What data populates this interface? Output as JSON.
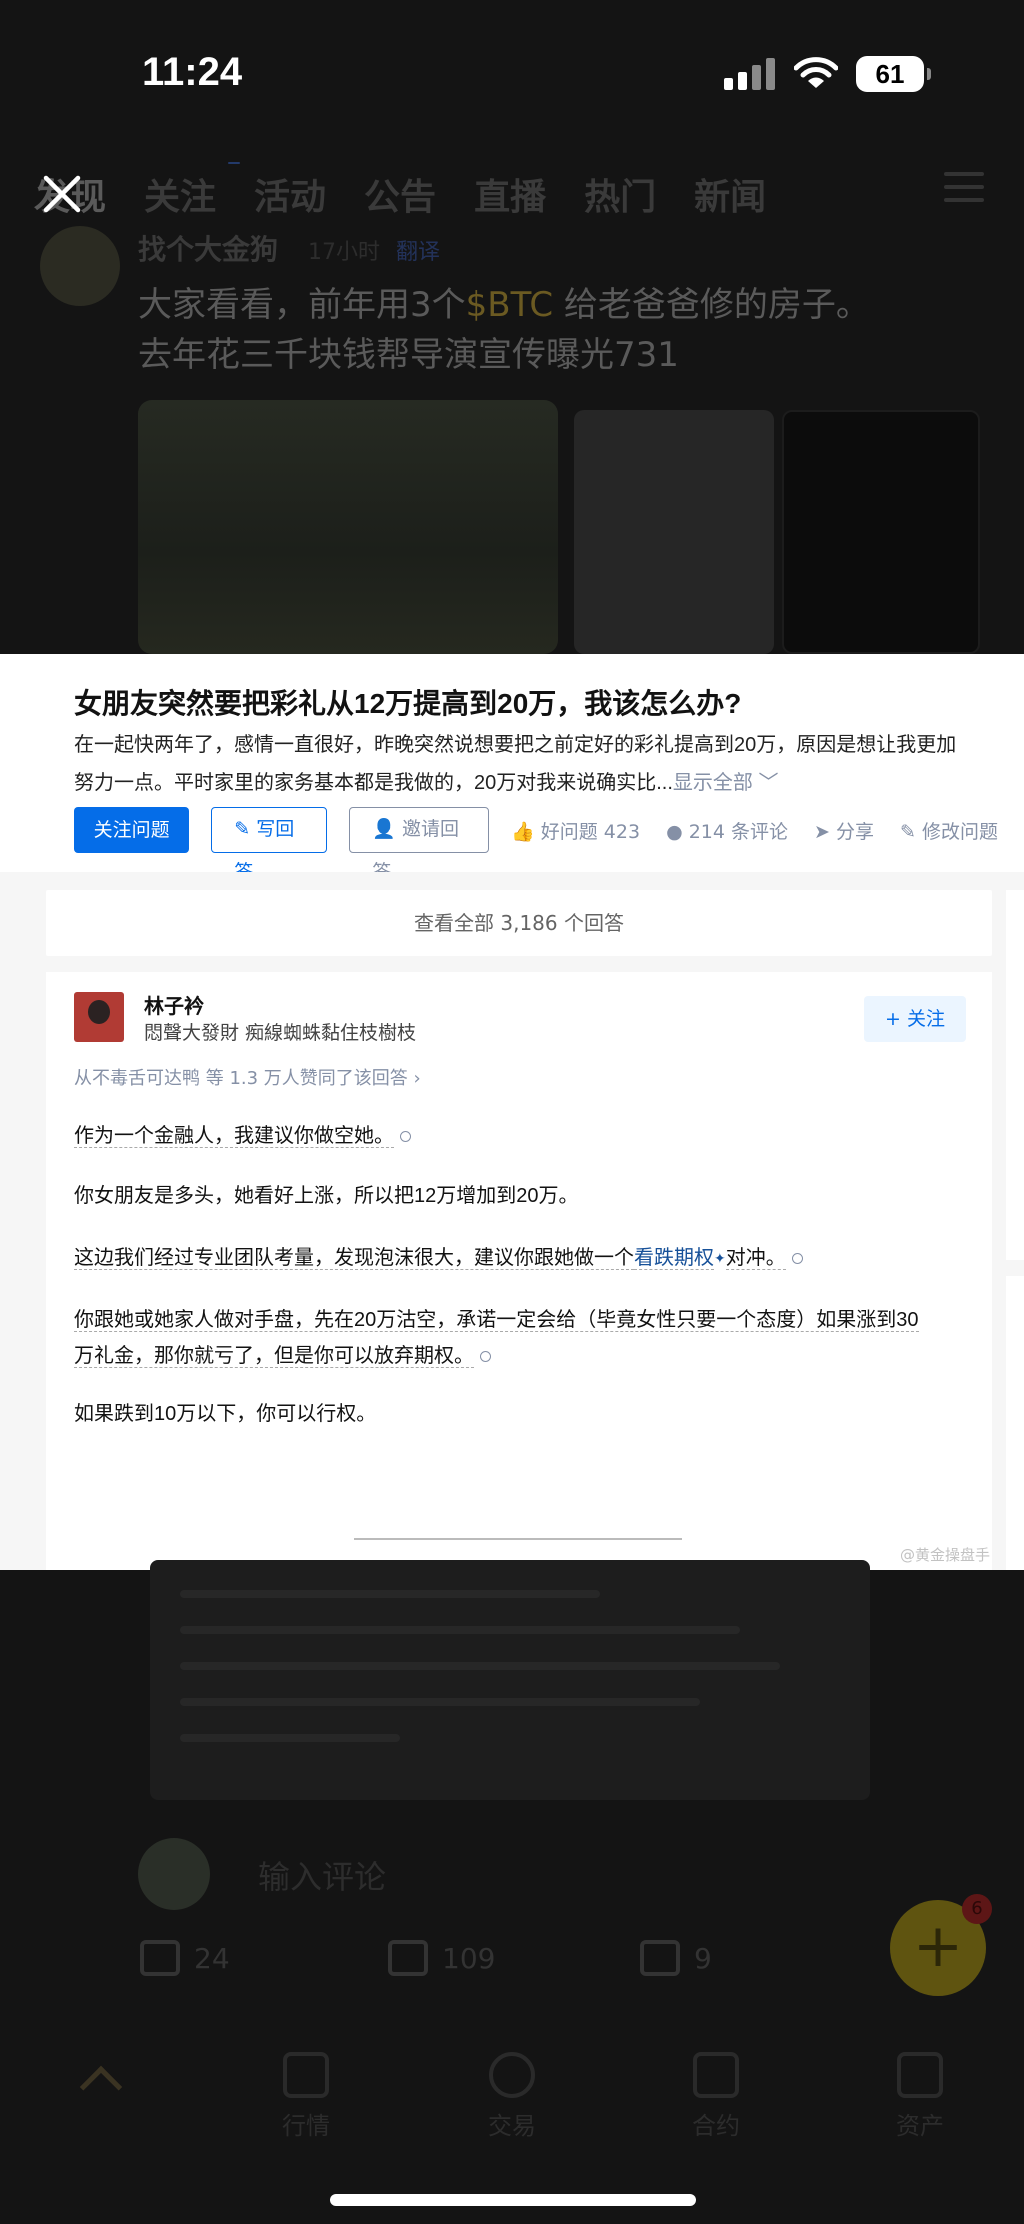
{
  "status_bar": {
    "time": "11:24",
    "battery": "61"
  },
  "background_app": {
    "tabs": [
      "发现",
      "关注",
      "活动",
      "公告",
      "直播",
      "热门",
      "新闻"
    ],
    "post_user": "找个大金狗",
    "post_time": "17小时",
    "post_translate": "翻译",
    "post_text_line1_a": "大家看看，前年用3个",
    "post_text_btc": "$BTC",
    "post_text_line1_b": " 给老爸爸修的房子。",
    "post_text_line2": "去年花三千块钱帮导演宣传曝光731",
    "comment_placeholder": "输入评论",
    "fab_badge": "6",
    "actions": {
      "comments": "24",
      "likes": "109",
      "reposts": "9"
    },
    "nav": [
      "行情",
      "交易",
      "合约",
      "资产"
    ]
  },
  "question": {
    "title": "女朋友突然要把彩礼从12万提高到20万，我该怎么办?",
    "desc_line1": "在一起快两年了，感情一直很好，昨晚突然说想要把之前定好的彩礼提高到20万，原因是想让我更加",
    "desc_line2": "努力一点。平时家里的家务基本都是我做的，20万对我来说确实比...",
    "desc_more": "显示全部 ﹀",
    "buttons": {
      "follow_question": "关注问题",
      "write_answer": "写回答",
      "invite_answer": "邀请回答",
      "good_question": "好问题 423",
      "comments": "214 条评论",
      "share": "分享",
      "edit": "修改问题"
    }
  },
  "view_all": "查看全部 3,186 个回答",
  "answer": {
    "author": "林子衿",
    "bio": "悶聲大發財 痴線蜘蛛黏住枝樹枝",
    "follow": "+ 关注",
    "endorsement": "从不毒舌可达鸭 等 1.3 万人赞同了该回答 ›",
    "p1": "作为一个金融人，我建议你做空她。",
    "p2": "你女朋友是多头，她看好上涨，所以把12万增加到20万。",
    "p3_a": "这边我们经过专业团队考量，发现泡沫很大，建议你跟她做一个",
    "p3_link": "看跌期权",
    "p3_b": "对冲。",
    "p4_line1": "你跟她或她家人做对手盘，先在20万沽空，承诺一定会给（毕竟女性只要一个态度）如果涨到30",
    "p4_line2": "万礼金，那你就亏了，但是你可以放弃期权。",
    "p5": "如果跌到10万以下，你可以行权。"
  },
  "watermark": "@黄金操盘手"
}
